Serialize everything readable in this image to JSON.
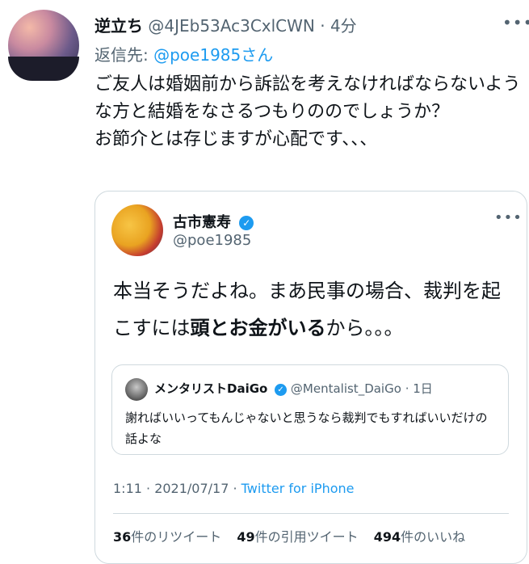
{
  "tweet": {
    "name": "逆立ち",
    "handle": "@4JEb53Ac3CxlCWN",
    "dot": "·",
    "time": "4分",
    "reply_prefix": "返信先:",
    "reply_to": "@poe1985さん",
    "text_lines": [
      "ご友人は婚姻前から訴訟を考えなければならないような方と結婚をなさるつもりののでしょうか？",
      "お節介とは存じますが心配です、、、"
    ]
  },
  "quoted": {
    "name": "古市憲寿",
    "handle": "@poe1985",
    "text_part1": "本当そうだよね。まあ民事の場合、裁判を起こすには",
    "text_bold1": "頭と",
    "text_bold2": "お金がいる",
    "text_part2": "から。。。",
    "inner_quote": {
      "name": "メンタリストDaiGo",
      "handle": "@Mentalist_DaiGo",
      "dot": "·",
      "time": "1日",
      "text": "謝ればいいってもんじゃないと思うなら裁判でもすればいいだけの話よな"
    },
    "timestamp": "1:11 · 2021/07/17 · ",
    "source": "Twitter for iPhone",
    "stats": [
      {
        "count": "36",
        "label": "件のリツイート"
      },
      {
        "count": "49",
        "label": "件の引用ツイート"
      },
      {
        "count": "494",
        "label": "件のいいね"
      }
    ]
  },
  "icons": {
    "more": "more-icon",
    "verified": "verified-badge-icon"
  },
  "colors": {
    "accent": "#1d9bf0",
    "muted": "#536471",
    "border": "#cfd9de"
  }
}
